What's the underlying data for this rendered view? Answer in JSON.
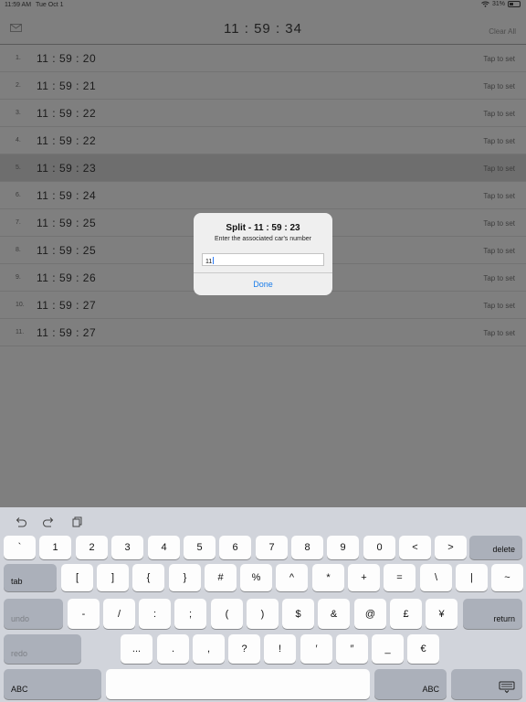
{
  "status": {
    "time": "11:59 AM",
    "date": "Tue Oct 1",
    "battery": "31%",
    "battery_level": 0.31
  },
  "nav": {
    "title": "11 : 59 : 34",
    "clear_all": "Clear All",
    "mail_icon": "envelope-icon"
  },
  "splits": [
    {
      "num": "1.",
      "time": "11 : 59 : 20",
      "action": "Tap to set"
    },
    {
      "num": "2.",
      "time": "11 : 59 : 21",
      "action": "Tap to set"
    },
    {
      "num": "3.",
      "time": "11 : 59 : 22",
      "action": "Tap to set"
    },
    {
      "num": "4.",
      "time": "11 : 59 : 22",
      "action": "Tap to set"
    },
    {
      "num": "5.",
      "time": "11 : 59 : 23",
      "action": "Tap to set",
      "selected": true
    },
    {
      "num": "6.",
      "time": "11 : 59 : 24",
      "action": "Tap to set"
    },
    {
      "num": "7.",
      "time": "11 : 59 : 25",
      "action": "Tap to set"
    },
    {
      "num": "8.",
      "time": "11 : 59 : 25",
      "action": "Tap to set"
    },
    {
      "num": "9.",
      "time": "11 : 59 : 26",
      "action": "Tap to set"
    },
    {
      "num": "10.",
      "time": "11 : 59 : 27",
      "action": "Tap to set"
    },
    {
      "num": "11.",
      "time": "11 : 59 : 27",
      "action": "Tap to set"
    }
  ],
  "dialog": {
    "title": "Split - 11 : 59 : 23",
    "subtitle": "Enter the associated car's number",
    "input_value": "11",
    "done": "Done"
  },
  "keyboard": {
    "toolbar_icons": [
      "undo-arrow-icon",
      "redo-arrow-icon",
      "clipboard-icon"
    ],
    "row1": [
      "`",
      "1",
      "2",
      "3",
      "4",
      "5",
      "6",
      "7",
      "8",
      "9",
      "0",
      "<",
      ">"
    ],
    "delete": "delete",
    "tab": "tab",
    "row2": [
      "[",
      "]",
      "{",
      "}",
      "#",
      "%",
      "^",
      "*",
      "+",
      "=",
      "\\",
      "|",
      "~"
    ],
    "undo": "undo",
    "row3": [
      "-",
      "/",
      ":",
      ";",
      "(",
      ")",
      "$",
      "&",
      "@",
      "£",
      "¥"
    ],
    "return": "return",
    "redo": "redo",
    "row4": [
      "...",
      ".",
      ",",
      "?",
      "!",
      "′",
      "″",
      "_",
      "€"
    ],
    "abc_left": "ABC",
    "abc_right": "ABC",
    "dismiss_icon": "keyboard-dismiss-icon"
  }
}
